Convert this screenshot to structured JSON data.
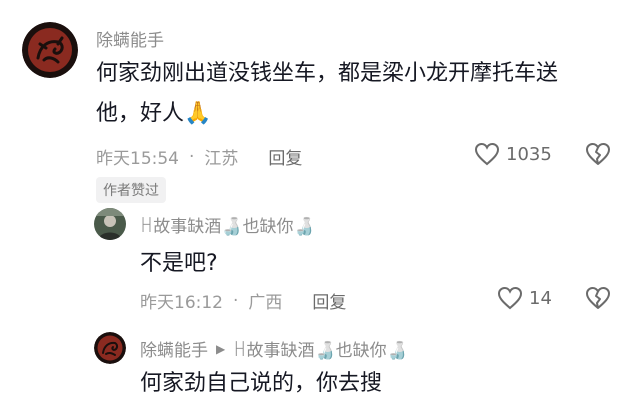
{
  "comment1": {
    "author": "除螨能手",
    "text": "何家劲刚出道没钱坐车，都是梁小龙开摩托车送他，好人",
    "emoji": "🙏",
    "time": "昨天15:54",
    "sep": "·",
    "location": "江苏",
    "reply_label": "回复",
    "likes": "1035",
    "badge": "作者赞过"
  },
  "reply1": {
    "author": "ꀿ故事缺酒🍶也缺你🍶",
    "text": "不是吧?",
    "time": "昨天16:12",
    "sep": "·",
    "location": "广西",
    "reply_label": "回复",
    "likes": "14"
  },
  "reply2": {
    "author": "除螨能手",
    "arrow": "▶",
    "target": "ꀿ故事缺酒🍶也缺你🍶",
    "text": "何家劲自己说的，你去搜"
  }
}
